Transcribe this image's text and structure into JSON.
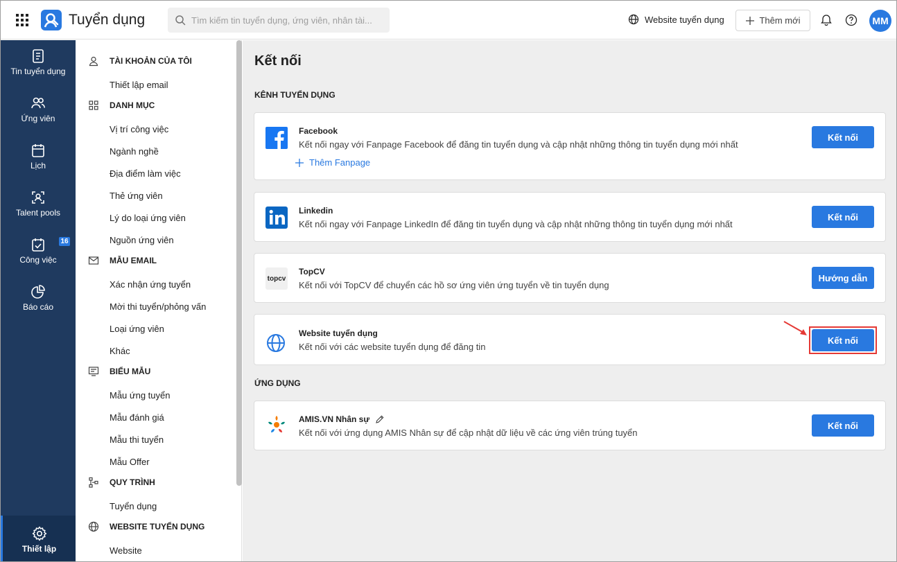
{
  "header": {
    "app_title": "Tuyển dụng",
    "search_placeholder": "Tìm kiếm tin tuyển dụng, ứng viên, nhân tài...",
    "website_link": "Website tuyển dụng",
    "add_new": "Thêm mới",
    "avatar_initials": "MM"
  },
  "leftnav": {
    "items": [
      {
        "label": "Tin tuyển dụng",
        "icon": "job-post-icon"
      },
      {
        "label": "Ứng viên",
        "icon": "candidates-icon"
      },
      {
        "label": "Lịch",
        "icon": "calendar-icon"
      },
      {
        "label": "Talent pools",
        "icon": "talent-pool-icon"
      },
      {
        "label": "Công việc",
        "icon": "task-icon",
        "badge": "16"
      },
      {
        "label": "Báo cáo",
        "icon": "report-icon"
      }
    ],
    "settings_label": "Thiết lập"
  },
  "sidebar": {
    "sections": [
      {
        "title": "TÀI KHOẢN CỦA TÔI",
        "icon": "user-icon",
        "items": [
          "Thiết lập email"
        ]
      },
      {
        "title": "DANH MỤC",
        "icon": "category-icon",
        "items": [
          "Vị trí công việc",
          "Ngành nghề",
          "Địa điểm làm việc",
          "Thẻ ứng viên",
          "Lý do loại ứng viên",
          "Nguồn ứng viên"
        ]
      },
      {
        "title": "MẪU EMAIL",
        "icon": "mail-icon",
        "items": [
          "Xác nhận ứng tuyển",
          "Mời thi tuyển/phỏng vấn",
          "Loại ứng viên",
          "Khác"
        ]
      },
      {
        "title": "BIỂU MẪU",
        "icon": "form-icon",
        "items": [
          "Mẫu ứng tuyển",
          "Mẫu đánh giá",
          "Mẫu thi tuyển",
          "Mẫu Offer"
        ]
      },
      {
        "title": "QUY TRÌNH",
        "icon": "workflow-icon",
        "items": [
          "Tuyển dụng"
        ]
      },
      {
        "title": "WEBSITE TUYỂN DỤNG",
        "icon": "globe-icon",
        "items": [
          "Website"
        ]
      }
    ]
  },
  "main": {
    "title": "Kết nối",
    "channels_title": "KÊNH TUYỂN DỤNG",
    "apps_title": "ỨNG DỤNG",
    "facebook": {
      "name": "Facebook",
      "desc": "Kết nối ngay với Fanpage Facebook để đăng tin tuyển dụng và cập nhật những thông tin tuyển dụng mới nhất",
      "extra": "Thêm Fanpage",
      "button": "Kết nối"
    },
    "linkedin": {
      "name": "Linkedin",
      "desc": "Kết nối ngay với Fanpage LinkedIn để đăng tin tuyển dụng và cập nhật những thông tin tuyển dụng mới nhất",
      "button": "Kết nối"
    },
    "topcv": {
      "name": "TopCV",
      "logo_text": "topcv",
      "desc": "Kết nối với TopCV để chuyển các hồ sơ ứng viên ứng tuyển về tin tuyển dụng",
      "button": "Hướng dẫn"
    },
    "website": {
      "name": "Website tuyển dụng",
      "desc": "Kết nối với các website tuyển dụng để đăng tin",
      "button": "Kết nối"
    },
    "amis": {
      "name": "AMIS.VN Nhân sự",
      "desc": "Kết nối với ứng dụng AMIS Nhân sự để cập nhật dữ liệu về các ứng viên trúng tuyển",
      "button": "Kết nối"
    }
  },
  "colors": {
    "accent": "#2979e0",
    "nav_bg": "#1f3a5f",
    "highlight": "#e53935"
  }
}
